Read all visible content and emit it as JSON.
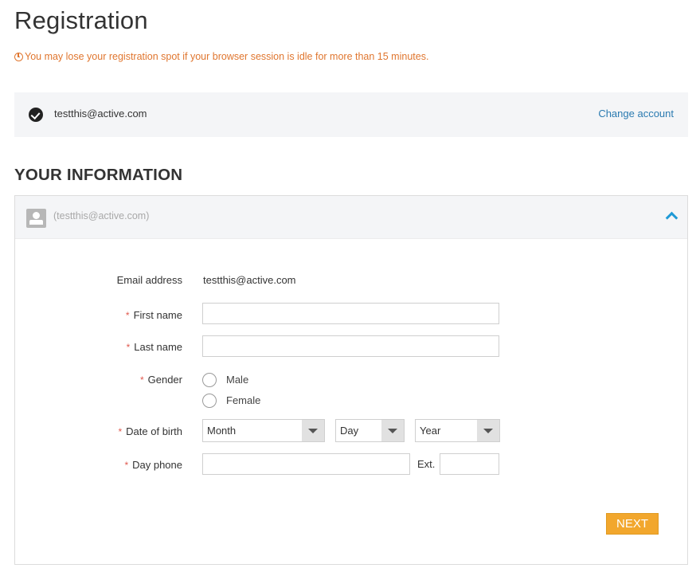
{
  "page": {
    "title": "Registration",
    "warning": "You may lose your registration spot if your browser session is idle for more than 15 minutes."
  },
  "account": {
    "email": "testthis@active.com",
    "change_label": "Change account"
  },
  "section": {
    "title": "YOUR INFORMATION"
  },
  "participant": {
    "header_label": "(testthis@active.com)"
  },
  "form": {
    "required_marker": "*",
    "email_label": "Email address",
    "email_value": "testthis@active.com",
    "first_name_label": "First name",
    "first_name_value": "",
    "last_name_label": "Last name",
    "last_name_value": "",
    "gender_label": "Gender",
    "gender_options": [
      "Male",
      "Female"
    ],
    "dob_label": "Date of birth",
    "dob_month": "Month",
    "dob_day": "Day",
    "dob_year": "Year",
    "phone_label": "Day phone",
    "phone_value": "",
    "ext_label": "Ext.",
    "ext_value": "",
    "next_label": "NEXT"
  },
  "colors": {
    "warning": "#e0762f",
    "link": "#2a7ab0",
    "accent_button": "#f2a72d",
    "chevron": "#1f9ad6",
    "required": "#e05a4f"
  },
  "icons": {
    "warning": "clock-warning-icon",
    "account": "check-circle-icon",
    "participant": "user-avatar-icon",
    "collapse": "chevron-up-icon",
    "select": "caret-down-icon"
  }
}
